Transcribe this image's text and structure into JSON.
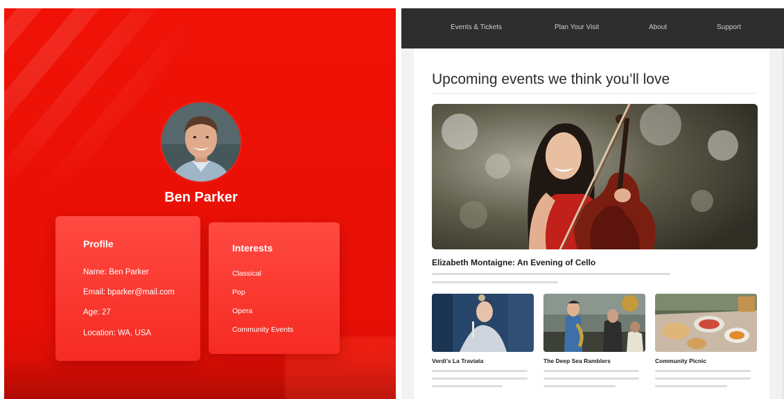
{
  "profile_panel": {
    "person_name": "Ben Parker",
    "profile_card": {
      "title": "Profile",
      "lines": [
        "Name: Ben Parker",
        "Email: bparker@mail.com",
        "Age: 27",
        "Location: WA, USA"
      ]
    },
    "interests_card": {
      "title": "Interests",
      "items": [
        "Classical",
        "Pop",
        "Opera",
        "Community Events"
      ]
    }
  },
  "site": {
    "nav": [
      "Events & Tickets",
      "Plan Your Visit",
      "About",
      "Support"
    ],
    "heading": "Upcoming events we think you’ll love",
    "featured_event": {
      "title": "Elizabeth Montaigne: An Evening of Cello"
    },
    "events": [
      {
        "title": "Verdi’s La Traviata",
        "icon": "opera-singer-image"
      },
      {
        "title": "The Deep Sea Ramblers",
        "icon": "band-image"
      },
      {
        "title": "Community Picnic",
        "icon": "picnic-food-image"
      }
    ]
  },
  "colors": {
    "brand_red": "#ee1106",
    "nav_bg": "#2d2d2d",
    "card_red": "#f83a31"
  }
}
